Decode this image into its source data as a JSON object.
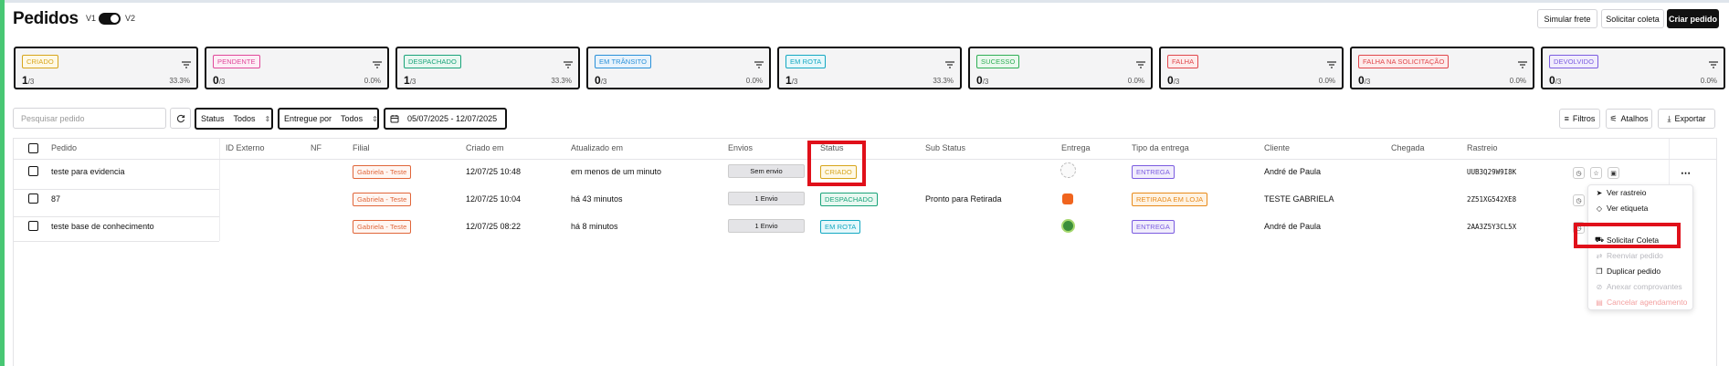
{
  "header": {
    "title": "Pedidos",
    "v1_label": "V1",
    "v2_label": "V2",
    "buttons": {
      "simulate": "Simular frete",
      "request_pickup": "Solicitar coleta",
      "create": "Criar pedido"
    }
  },
  "cards": [
    {
      "label": "CRIADO",
      "count": "1",
      "total": "/3",
      "pct": "33.3%",
      "color": "#d7a51c",
      "bg": "#fff9e6"
    },
    {
      "label": "PENDENTE",
      "count": "0",
      "total": "/3",
      "pct": "0.0%",
      "color": "#e0489a",
      "bg": "#fdeef6"
    },
    {
      "label": "DESPACHADO",
      "count": "1",
      "total": "/3",
      "pct": "33.3%",
      "color": "#1aa37a",
      "bg": "#e8f8f1"
    },
    {
      "label": "EM TRÂNSITO",
      "count": "0",
      "total": "/3",
      "pct": "0.0%",
      "color": "#2a90d8",
      "bg": "#e8f3fc"
    },
    {
      "label": "EM ROTA",
      "count": "1",
      "total": "/3",
      "pct": "33.3%",
      "color": "#14a8c2",
      "bg": "#e6f8fb"
    },
    {
      "label": "SUCESSO",
      "count": "0",
      "total": "/3",
      "pct": "0.0%",
      "color": "#2fae55",
      "bg": "#eaf8ee"
    },
    {
      "label": "FALHA",
      "count": "0",
      "total": "/3",
      "pct": "0.0%",
      "color": "#e0474c",
      "bg": "#fdecec"
    },
    {
      "label": "FALHA NA SOLICITAÇÃO",
      "count": "0",
      "total": "/3",
      "pct": "0.0%",
      "color": "#e0474c",
      "bg": "#fdecec"
    },
    {
      "label": "DEVOLVIDO",
      "count": "0",
      "total": "/3",
      "pct": "0.0%",
      "color": "#7b5ce0",
      "bg": "#f1edfc"
    }
  ],
  "toolbar": {
    "search_placeholder": "Pesquisar pedido",
    "status_label": "Status",
    "status_value": "Todos",
    "delivered_label": "Entregue por",
    "delivered_value": "Todos",
    "date_range": "05/07/2025 - 12/07/2025",
    "filters": "Filtros",
    "shortcuts": "Atalhos",
    "export": "Exportar"
  },
  "table": {
    "columns": [
      "Pedido",
      "ID Externo",
      "NF",
      "Filial",
      "Criado em",
      "Atualizado em",
      "Envios",
      "Status",
      "Sub Status",
      "Entrega",
      "Tipo da entrega",
      "Cliente",
      "Chegada",
      "Rastreio"
    ],
    "rows": [
      {
        "pedido": "teste para evidencia",
        "filial": "Gabriela - Teste",
        "criado": "12/07/25 10:48",
        "atualizado": "em menos de um minuto",
        "envios": "Sem envio",
        "status": "CRIADO",
        "sub_status": "",
        "tipo": "ENTREGA",
        "cliente": "André de Paula",
        "rastreio": "UUB3Q29W9I8K"
      },
      {
        "pedido": "87",
        "filial": "Gabriela - Teste",
        "criado": "12/07/25 10:04",
        "atualizado": "há 43 minutos",
        "envios": "1 Envio",
        "status": "DESPACHADO",
        "sub_status": "Pronto para Retirada",
        "tipo": "RETIRADA EM LOJA",
        "cliente": "TESTE GABRIELA",
        "rastreio": "2Z51XG542XE8"
      },
      {
        "pedido": "teste base de conhecimento",
        "filial": "Gabriela - Teste",
        "criado": "12/07/25 08:22",
        "atualizado": "há 8 minutos",
        "envios": "1 Envio",
        "status": "EM ROTA",
        "sub_status": "",
        "tipo": "ENTREGA",
        "cliente": "André de Paula",
        "rastreio": "2AA3Z5Y3CL5X"
      }
    ]
  },
  "menu": {
    "items": [
      {
        "label": "Ver rastreio",
        "icon": "send-icon",
        "state": "normal"
      },
      {
        "label": "Ver etiqueta",
        "icon": "tag-icon",
        "state": "normal"
      },
      {
        "label": "Solicitar Coleta",
        "icon": "truck-icon",
        "state": "normal"
      },
      {
        "label": "Reenviar pedido",
        "icon": "resend-icon",
        "state": "disabled"
      },
      {
        "label": "Duplicar pedido",
        "icon": "copy-icon",
        "state": "normal"
      },
      {
        "label": "Anexar comprovantes",
        "icon": "paperclip-icon",
        "state": "disabled"
      },
      {
        "label": "Cancelar agendamento",
        "icon": "calendar-x-icon",
        "state": "danger"
      }
    ]
  },
  "highlight_color": "#e0101a"
}
